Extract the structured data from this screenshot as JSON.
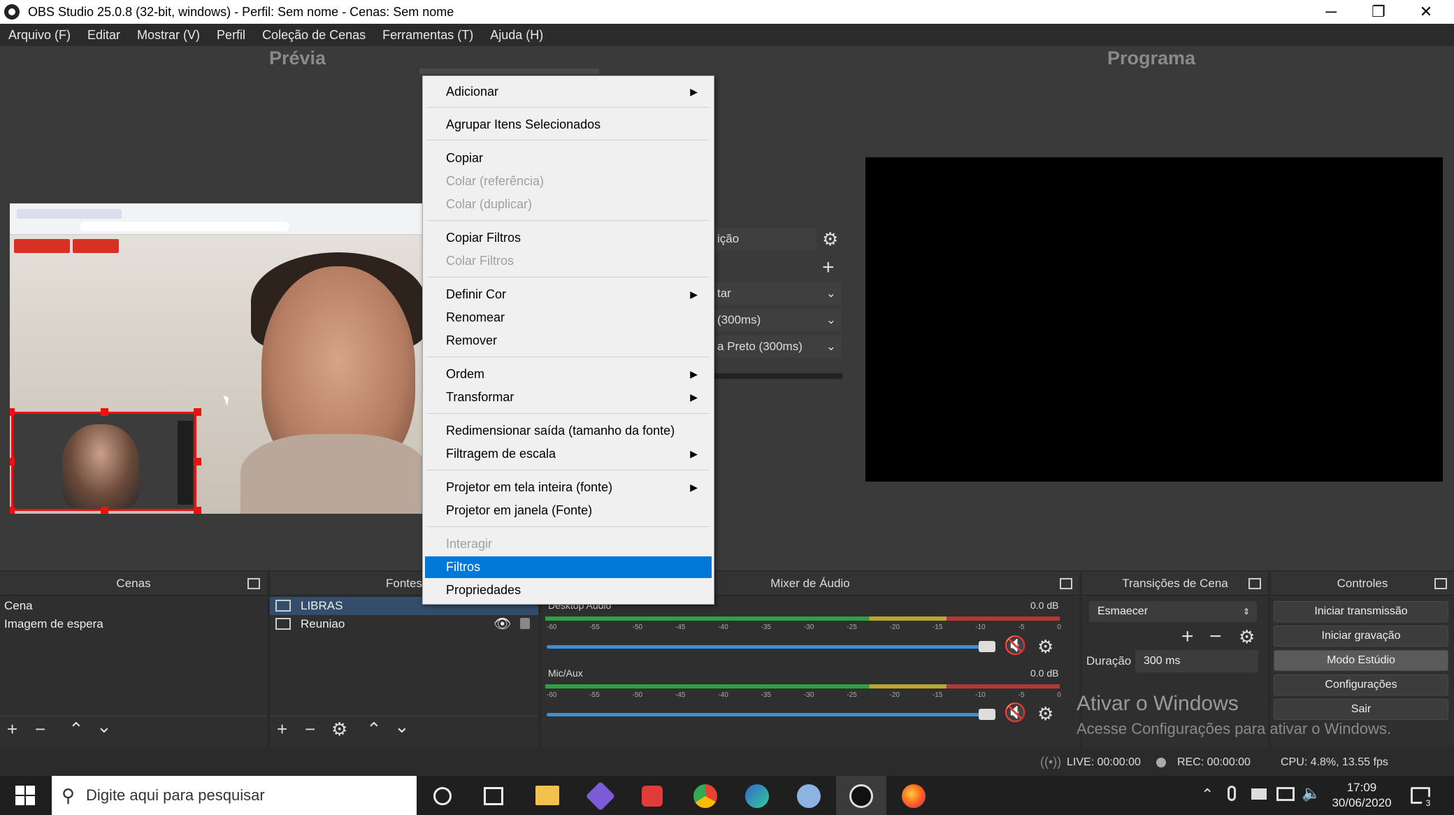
{
  "window": {
    "title": "OBS Studio 25.0.8 (32-bit, windows) - Perfil: Sem nome - Cenas: Sem nome",
    "controls": {
      "minimize": "─",
      "restore": "❐",
      "close": "✕"
    }
  },
  "menubar": {
    "items": [
      "Arquivo (F)",
      "Editar",
      "Mostrar (V)",
      "Perfil",
      "Coleção de Cenas",
      "Ferramentas (T)",
      "Ajuda (H)"
    ]
  },
  "preview": {
    "title": "Prévia"
  },
  "program": {
    "title": "Programa"
  },
  "transition_panel": {
    "partial_duplicate": "ição",
    "partial_select1": "tar",
    "partial_select2": "(300ms)",
    "partial_select3": "a Preto (300ms)"
  },
  "context_menu": {
    "items": [
      {
        "label": "Adicionar",
        "submenu": true,
        "disabled": false
      },
      {
        "label": "Agrupar Itens Selecionados",
        "submenu": false,
        "disabled": false
      },
      {
        "label": "Copiar",
        "submenu": false,
        "disabled": false
      },
      {
        "label": "Colar (referência)",
        "submenu": false,
        "disabled": true
      },
      {
        "label": "Colar (duplicar)",
        "submenu": false,
        "disabled": true
      },
      {
        "label": "Copiar Filtros",
        "submenu": false,
        "disabled": false
      },
      {
        "label": "Colar Filtros",
        "submenu": false,
        "disabled": true
      },
      {
        "label": "Definir Cor",
        "submenu": true,
        "disabled": false
      },
      {
        "label": "Renomear",
        "submenu": false,
        "disabled": false
      },
      {
        "label": "Remover",
        "submenu": false,
        "disabled": false
      },
      {
        "label": "Ordem",
        "submenu": true,
        "disabled": false
      },
      {
        "label": "Transformar",
        "submenu": true,
        "disabled": false
      },
      {
        "label": "Redimensionar saída (tamanho da fonte)",
        "submenu": false,
        "disabled": false
      },
      {
        "label": "Filtragem de escala",
        "submenu": true,
        "disabled": false
      },
      {
        "label": "Projetor em tela inteira (fonte)",
        "submenu": true,
        "disabled": false
      },
      {
        "label": "Projetor em janela (Fonte)",
        "submenu": false,
        "disabled": false
      },
      {
        "label": "Interagir",
        "submenu": false,
        "disabled": true
      },
      {
        "label": "Filtros",
        "submenu": false,
        "disabled": false,
        "selected": true
      },
      {
        "label": "Propriedades",
        "submenu": false,
        "disabled": false
      }
    ]
  },
  "scenes": {
    "title": "Cenas",
    "items": [
      "Cena",
      "Imagem de espera"
    ]
  },
  "sources": {
    "title": "Fontes",
    "items": [
      "LIBRAS",
      "Reuniao"
    ]
  },
  "mixer": {
    "title": "Mixer de Áudio",
    "tracks": [
      {
        "name": "Desktop Audio",
        "db": "0.0 dB",
        "level": 0.95
      },
      {
        "name": "Mic/Aux",
        "db": "0.0 dB",
        "level": 0.95
      }
    ],
    "scale": [
      "-60",
      "-55",
      "-50",
      "-45",
      "-40",
      "-35",
      "-30",
      "-25",
      "-20",
      "-15",
      "-10",
      "-5",
      "0"
    ]
  },
  "transitions": {
    "title": "Transições de Cena",
    "selected": "Esmaecer",
    "duration_label": "Duração",
    "duration_value": "300 ms"
  },
  "controls": {
    "title": "Controles",
    "buttons": [
      "Iniciar transmissão",
      "Iniciar gravação",
      "Modo Estúdio",
      "Configurações",
      "Sair"
    ]
  },
  "watermark": {
    "line1": "Ativar o Windows",
    "line2": "Acesse Configurações para ativar o Windows."
  },
  "status": {
    "live": "LIVE: 00:00:00",
    "rec": "REC: 00:00:00",
    "cpu": "CPU: 4.8%, 13.55 fps"
  },
  "taskbar": {
    "search_placeholder": "Digite aqui para pesquisar",
    "time": "17:09",
    "date": "30/06/2020",
    "notifications": "3"
  },
  "colors": {
    "accent": "#0078d7",
    "recording": "#e11d1d",
    "mute": "#e02020"
  }
}
